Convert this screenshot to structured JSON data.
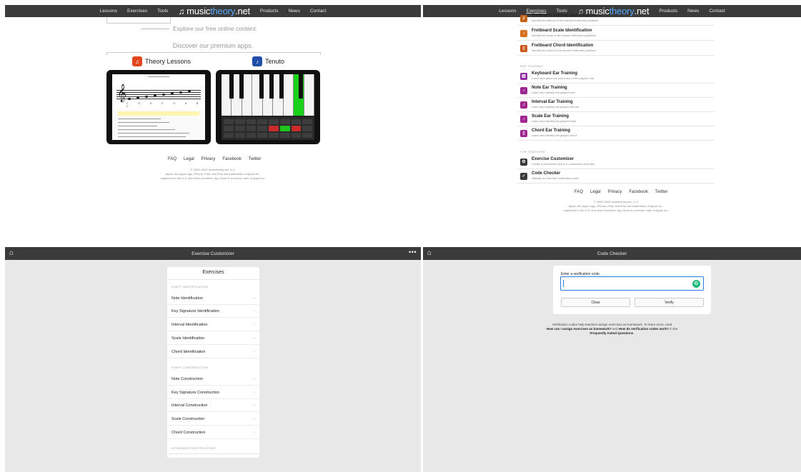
{
  "nav": {
    "lessons": "Lessons",
    "exercises": "Exercises",
    "tools": "Tools",
    "logo_prefix": "music",
    "logo_accent": "theory",
    "logo_suffix": ".net",
    "products": "Products",
    "news": "News",
    "contact": "Contact"
  },
  "home": {
    "explore": "Explore our free online content.",
    "discover": "Discover our premium apps.",
    "app1": "Theory Lessons",
    "app2": "Tenuto",
    "note_letters": "C D E F G A B C"
  },
  "footer": {
    "links": [
      "FAQ",
      "Legal",
      "Privacy",
      "Facebook",
      "Twitter"
    ],
    "copy1": "© 2000–2020 musictheory.net, LLC",
    "copy2": "Apple, the Apple logo, iPhone, iPad, and iPod are trademarks of Apple Inc.,",
    "copy3": "registered in the U.S. and other countries. App Store is a service mark of Apple Inc."
  },
  "exercise_list": {
    "items": [
      {
        "title": "Fretboard Interval Identification",
        "desc": "Identify the interval of the marked fretboard positions.",
        "color": "#c1621a",
        "glyph": "♯"
      },
      {
        "title": "Fretboard Scale Identification",
        "desc": "Identify the scale of the marked fretboard positions.",
        "color": "#d66f1e",
        "glyph": "♪"
      },
      {
        "title": "Fretboard Chord Identification",
        "desc": "Identify the chord of the marked fretboard positions.",
        "color": "#c7561a",
        "glyph": "▯"
      }
    ],
    "ear_head": "EAR TRAINING",
    "ear_items": [
      {
        "title": "Keyboard Ear Training",
        "desc": "Listen and press the piano key of the played note.",
        "color": "#8c2a9e",
        "glyph": "▥"
      },
      {
        "title": "Note Ear Training",
        "desc": "Listen and identify the played note.",
        "color": "#9a2790",
        "glyph": "♪"
      },
      {
        "title": "Interval Ear Training",
        "desc": "Listen and identify the played interval.",
        "color": "#a0238a",
        "glyph": "♫"
      },
      {
        "title": "Scale Ear Training",
        "desc": "Listen and identify the played scale.",
        "color": "#a1268f",
        "glyph": "♪"
      },
      {
        "title": "Chord Ear Training",
        "desc": "Listen and identify the played chord.",
        "color": "#9c2591",
        "glyph": "▯"
      }
    ],
    "teach_head": "FOR TEACHERS",
    "teach_items": [
      {
        "title": "Exercise Customizer",
        "desc": "Create a permanent link to a customized exercise.",
        "color": "#3a3a3a",
        "glyph": "⚙"
      },
      {
        "title": "Code Checker",
        "desc": "Validate an exercise verification code.",
        "color": "#3a3a3a",
        "glyph": "✓"
      }
    ]
  },
  "customizer": {
    "bar_title": "Exercise Customizer",
    "more": "•••",
    "card_title": "Exercises",
    "staff_id_head": "STAFF IDENTIFICATION",
    "staff_id": [
      "Note Identification",
      "Key Signature Identification",
      "Interval Identification",
      "Scale Identification",
      "Chord Identification"
    ],
    "staff_con_head": "STAFF CONSTRUCTION",
    "staff_con": [
      "Note Construction",
      "Key Signature Construction",
      "Interval Construction",
      "Scale Construction",
      "Chord Construction"
    ],
    "kb_head": "KEYBOARD IDENTIFICATION",
    "chevron": "›"
  },
  "code_checker": {
    "bar_title": "Code Checker",
    "label": "Enter a verification code:",
    "value": "",
    "clear": "Clear",
    "verify": "Verify",
    "info1": "Verification codes help teachers assign exercises as homework. To learn more, read",
    "q1": "How can I assign exercises as homework?",
    "and": " and ",
    "q2": "How do verification codes work?",
    "in_the": " in the",
    "faq": "Frequently Asked Questions",
    "dot": "."
  },
  "colors": {
    "navbar": "#3b3b3b",
    "accent": "#58a9ff",
    "input_focus": "#2a7de1",
    "grammarly": "#1db97c"
  }
}
